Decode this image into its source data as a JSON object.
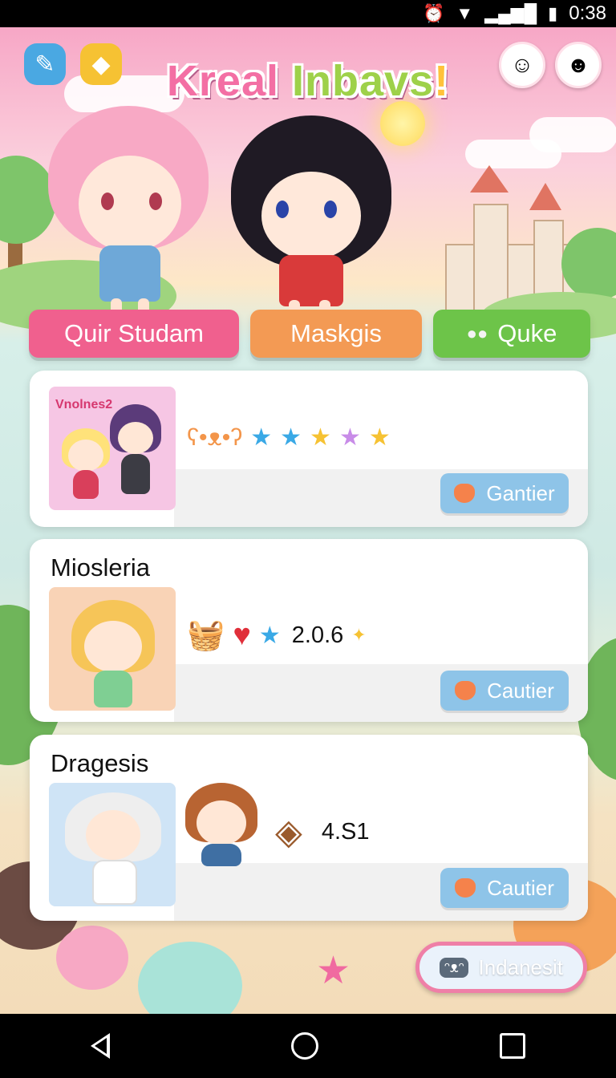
{
  "status_bar": {
    "time": "0:38"
  },
  "header": {
    "title_part1": "Kreal ",
    "title_part2": "Inbavs",
    "title_part3": "!"
  },
  "tabs": [
    {
      "label": "Quir Studam"
    },
    {
      "label": "Maskgis"
    },
    {
      "label": "Quke"
    }
  ],
  "cards": [
    {
      "title": "",
      "thumb_text": "Vnolnes2",
      "stat": "",
      "button_label": "Gantier"
    },
    {
      "title": "Miosleria",
      "stat": "2.0.6",
      "button_label": "Cautier"
    },
    {
      "title": "Dragesis",
      "stat": "4.S1",
      "button_label": "Cautier"
    }
  ],
  "language_button": {
    "label": "Indanesit"
  },
  "colors": {
    "tab_pink": "#f0608e",
    "tab_orange": "#f39a54",
    "tab_green": "#6dc449",
    "button_blue": "#8ec4e8"
  }
}
